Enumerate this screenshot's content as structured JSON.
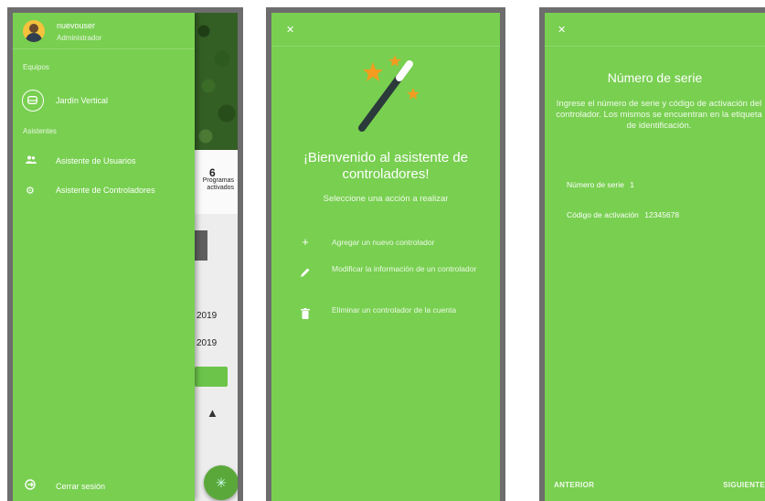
{
  "screen1": {
    "background_app": {
      "count": "6",
      "count_label": "Programas activados",
      "date1": "2019",
      "date2": "2019"
    },
    "drawer": {
      "user_name": "nuevouser",
      "user_role": "Administrador",
      "section_devices": "Equipos",
      "device_item": "Jardín Vertical",
      "section_assistants": "Asistentes",
      "assistant_users": "Asistente de Usuarios",
      "assistant_controllers": "Asistente de Controladores",
      "logout": "Cerrar sesión"
    }
  },
  "screen2": {
    "title": "¡Bienvenido al asistente de controladores!",
    "subtitle": "Seleccione una acción a realizar",
    "options": [
      {
        "icon": "plus-icon",
        "label": "Agregar un nuevo controlador"
      },
      {
        "icon": "pencil-icon",
        "label": "Modificar la información de un controlador"
      },
      {
        "icon": "trash-icon",
        "label": "Eliminar un controlador de la cuenta"
      }
    ]
  },
  "screen3": {
    "title": "Número de serie",
    "description": "Ingrese el número de serie y código de activación del controlador. Los mismos se encuentran en la etiqueta de identificación.",
    "serial_label": "Número de serie",
    "serial_value": "1",
    "activation_label": "Código de activación",
    "activation_value": "12345678",
    "prev": "ANTERIOR",
    "next": "SIGUIENTE"
  },
  "colors": {
    "primary_green": "#78cf50",
    "frame_grey": "#6d6d6d"
  }
}
